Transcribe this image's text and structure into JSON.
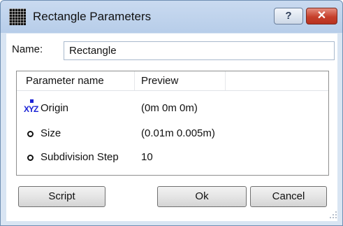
{
  "window": {
    "title": "Rectangle Parameters",
    "help_label": "?",
    "close_label": "✕",
    "icon": "grid-app-icon"
  },
  "name_field": {
    "label": "Name:",
    "value": "Rectangle"
  },
  "table": {
    "columns": [
      "Parameter name",
      "Preview"
    ],
    "rows": [
      {
        "icon": "xyz-icon",
        "icon_text": "XYZ",
        "name": "Origin",
        "preview": "(0m 0m 0m)"
      },
      {
        "icon": "radio-icon",
        "name": "Size",
        "preview": "(0.01m 0.005m)"
      },
      {
        "icon": "radio-icon",
        "name": "Subdivision Step",
        "preview": "10"
      }
    ]
  },
  "buttons": {
    "script": "Script",
    "ok": "Ok",
    "cancel": "Cancel"
  },
  "colors": {
    "xyz_icon": "#1c24d6",
    "close_button": "#c6402c"
  }
}
